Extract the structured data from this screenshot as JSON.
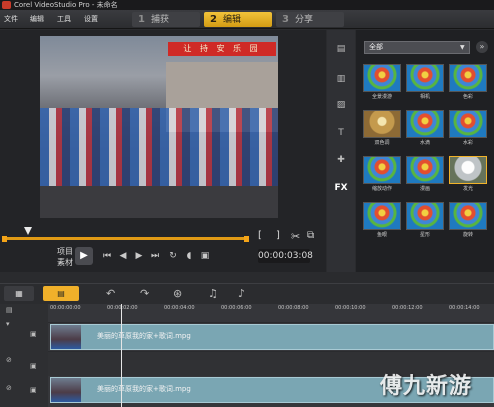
{
  "window": {
    "title": "Corel VideoStudio Pro - 未命名"
  },
  "menu": {
    "file": "文件",
    "edit": "编辑",
    "tools": "工具",
    "settings": "设置"
  },
  "steps": [
    {
      "num": "1",
      "label": "捕获"
    },
    {
      "num": "2",
      "label": "编辑"
    },
    {
      "num": "3",
      "label": "分享"
    }
  ],
  "preview": {
    "banner_text": "让 持 安 乐 园",
    "label_project": "项目",
    "label_clip": "素材",
    "timecode": "00:00:03:08",
    "mark_in": "[",
    "mark_out": "]"
  },
  "library": {
    "category": "全部",
    "thumbnails": [
      {
        "caption": "全景漫游"
      },
      {
        "caption": "相机"
      },
      {
        "caption": "色彩"
      },
      {
        "caption": "双色调"
      },
      {
        "caption": "水滴"
      },
      {
        "caption": "水彩"
      },
      {
        "caption": "缩放动作"
      },
      {
        "caption": "漫画"
      },
      {
        "caption": "发光"
      },
      {
        "caption": "鱼眼"
      },
      {
        "caption": "星形"
      },
      {
        "caption": "旋转"
      }
    ]
  },
  "timeline": {
    "tooltip": "重复",
    "ruler": [
      "00:00:00:00",
      "00:00:02:00",
      "00:00:04:00",
      "00:00:06:00",
      "00:00:08:00",
      "00:00:10:00",
      "00:00:12:00",
      "00:00:14:00"
    ],
    "clips": [
      {
        "name": "美丽的草原我的家+歌词.mpg"
      },
      {
        "name": "美丽的草原我的家+歌词.mpg"
      }
    ]
  },
  "watermark": {
    "text": "傅九新游"
  },
  "colors": {
    "accent": "#f0b02a",
    "clip": "#7aa6b3",
    "banner": "#cf2a26"
  }
}
